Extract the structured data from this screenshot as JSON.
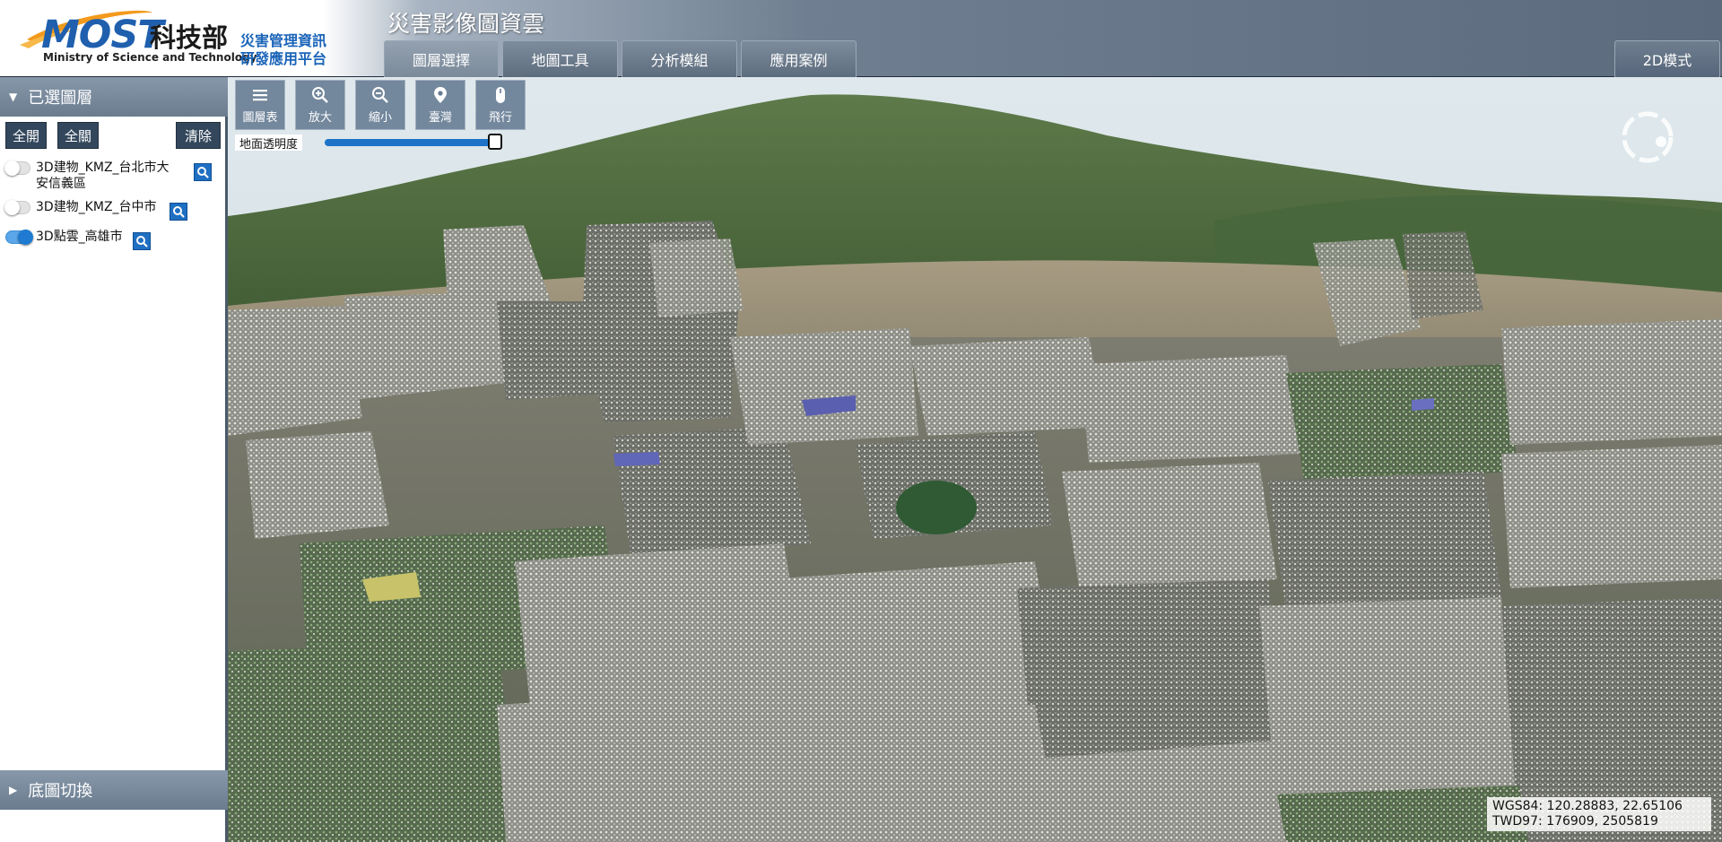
{
  "header": {
    "logo": {
      "word": "MOST",
      "cn": "科技部",
      "en": "Ministry of Science and Technology",
      "sub_line1": "災害管理資訊",
      "sub_line2": "研發應用平台"
    },
    "title": "災害影像圖資雲",
    "tabs": [
      {
        "label": "圖層選擇",
        "active": true
      },
      {
        "label": "地圖工具",
        "active": false
      },
      {
        "label": "分析模組",
        "active": false
      },
      {
        "label": "應用案例",
        "active": false
      }
    ],
    "mode_button": "2D模式"
  },
  "sidebar": {
    "selected_layers": {
      "title": "已選圖層",
      "expanded": true,
      "buttons": {
        "all_on": "全開",
        "all_off": "全關",
        "clear": "清除"
      },
      "layers": [
        {
          "name_line1": "3D建物_KMZ_台北市大",
          "name_line2": "安信義區",
          "on": false
        },
        {
          "name_line1": "3D建物_KMZ_台中市",
          "on": false
        },
        {
          "name_line1": "3D點雲_高雄市",
          "on": true
        }
      ]
    },
    "basemap": {
      "title": "底圖切換",
      "expanded": false
    }
  },
  "map": {
    "toolbar": [
      {
        "label": "圖層表",
        "icon": "list-icon"
      },
      {
        "label": "放大",
        "icon": "zoom-in-icon"
      },
      {
        "label": "縮小",
        "icon": "zoom-out-icon"
      },
      {
        "label": "臺灣",
        "icon": "map-pin-icon"
      },
      {
        "label": "飛行",
        "icon": "mouse-icon"
      }
    ],
    "ground_opacity_label": "地面透明度",
    "ground_opacity_value": 1.0,
    "coords": {
      "wgs84": "WGS84: 120.28883, 22.65106",
      "twd97": "TWD97: 176909, 2505819"
    }
  },
  "colors": {
    "accent_blue": "#1e73c8",
    "sidebar_header": "#7588a0",
    "button_dark": "#33475c"
  }
}
